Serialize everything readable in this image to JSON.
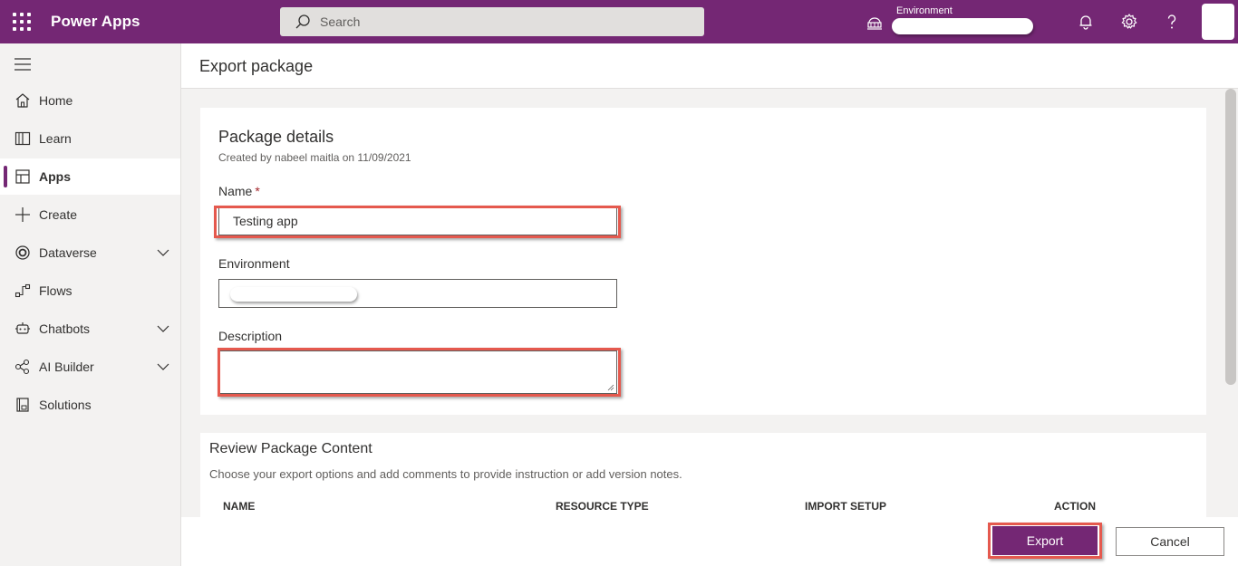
{
  "topbar": {
    "app_name": "Power Apps",
    "search_placeholder": "Search",
    "environment_label": "Environment",
    "icons": [
      "waffle-icon",
      "search-icon",
      "environment-icon",
      "notifications-icon",
      "settings-icon",
      "help-icon"
    ],
    "brand_color": "#742774"
  },
  "sidebar": {
    "items": [
      {
        "label": "Home",
        "icon": "home-icon",
        "active": false,
        "expandable": false
      },
      {
        "label": "Learn",
        "icon": "book-icon",
        "active": false,
        "expandable": false
      },
      {
        "label": "Apps",
        "icon": "apps-icon",
        "active": true,
        "expandable": false
      },
      {
        "label": "Create",
        "icon": "plus-icon",
        "active": false,
        "expandable": false
      },
      {
        "label": "Dataverse",
        "icon": "dataverse-icon",
        "active": false,
        "expandable": true
      },
      {
        "label": "Flows",
        "icon": "flows-icon",
        "active": false,
        "expandable": false
      },
      {
        "label": "Chatbots",
        "icon": "chatbot-icon",
        "active": false,
        "expandable": true
      },
      {
        "label": "AI Builder",
        "icon": "ai-builder-icon",
        "active": false,
        "expandable": true
      },
      {
        "label": "Solutions",
        "icon": "solutions-icon",
        "active": false,
        "expandable": false
      }
    ]
  },
  "page": {
    "title": "Export package"
  },
  "package_details": {
    "title": "Package details",
    "subtitle": "Created by nabeel maitla on 11/09/2021",
    "name_label": "Name",
    "name_required": "*",
    "name_value": "Testing app",
    "environment_label": "Environment",
    "description_label": "Description",
    "description_value": ""
  },
  "review": {
    "title": "Review Package Content",
    "subtitle": "Choose your export options and add comments to provide instruction or add version notes.",
    "columns": [
      "NAME",
      "RESOURCE TYPE",
      "IMPORT SETUP",
      "ACTION"
    ]
  },
  "footer": {
    "export_label": "Export",
    "cancel_label": "Cancel"
  },
  "annotation_color": "#e5594e"
}
